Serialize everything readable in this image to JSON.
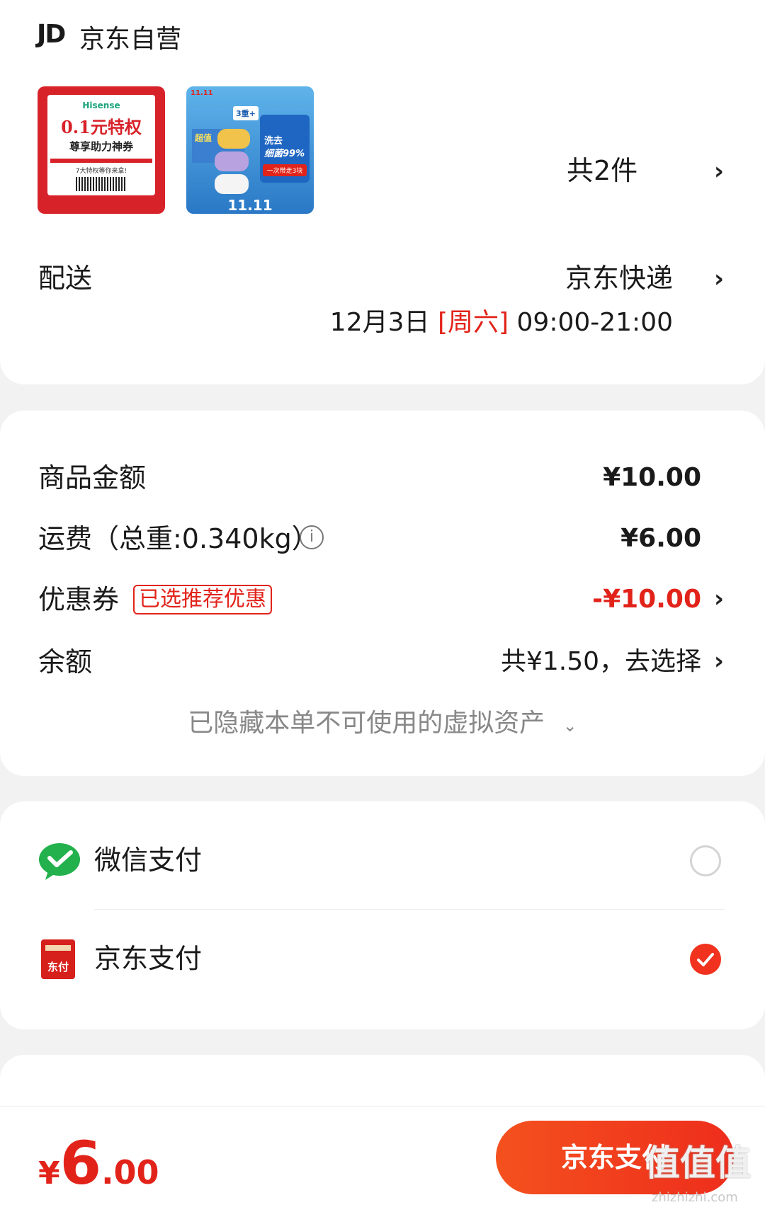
{
  "store": {
    "logo": "JD",
    "name": "京东自营",
    "item_count": "共2件"
  },
  "products": [
    {
      "brand": "Hisense",
      "line1": "0.1元特权",
      "line2": "尊享助力神券",
      "line3": "7大特权等你来拿!"
    },
    {
      "tag": "11.11",
      "badge": "3重+",
      "line1": "超值",
      "line2": "洗去",
      "line3": "细菌99%",
      "line4": "一次带走3块",
      "footer": "11.11"
    }
  ],
  "delivery": {
    "label": "配送",
    "method": "京东快递",
    "date": "12月3日",
    "weekday": "[周六]",
    "time": "09:00-21:00"
  },
  "amounts": {
    "goods_label": "商品金额",
    "goods_value": "¥10.00",
    "shipping_label": "运费（总重:0.340kg）",
    "shipping_value": "¥6.00",
    "coupon_label": "优惠券",
    "coupon_tag": "已选推荐优惠",
    "coupon_value": "-¥10.00",
    "balance_label": "余额",
    "balance_value": "共¥1.50，去选择",
    "hidden_note": "已隐藏本单不可使用的虚拟资产"
  },
  "payment": {
    "wechat_label": "微信支付",
    "wechat_selected": false,
    "jd_label": "京东支付",
    "jd_icon_text": "东付",
    "jd_selected": true
  },
  "footer": {
    "currency": "¥",
    "total_int": "6",
    "total_dec": ".00",
    "pay_button": "京东支付",
    "watermark": "值值值",
    "watermark_url": "zhizhizhi.com"
  },
  "colors": {
    "accent": "#e2231a",
    "button": "#f0321e",
    "wechat": "#22b14c",
    "link_gray": "#888888"
  }
}
